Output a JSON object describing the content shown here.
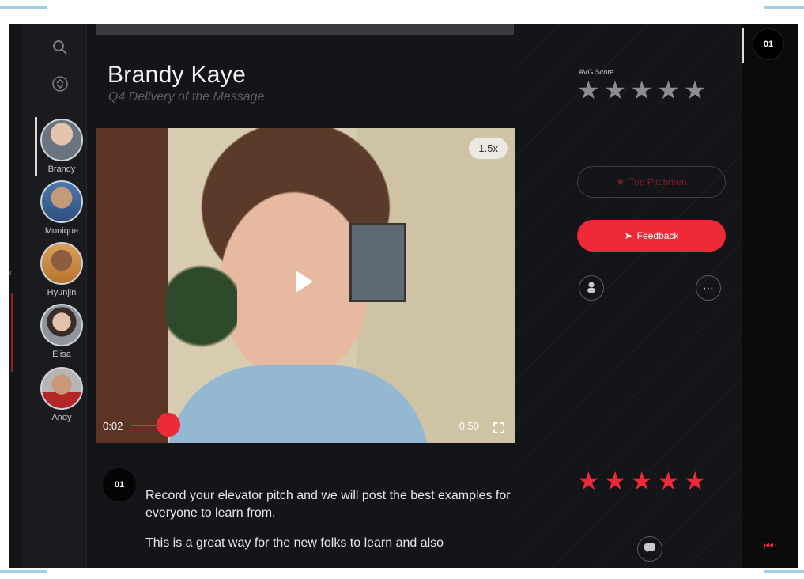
{
  "sidebar": {
    "people": [
      {
        "name": "Brandy"
      },
      {
        "name": "Monique"
      },
      {
        "name": "Hyunjin"
      },
      {
        "name": "Elisa"
      },
      {
        "name": "Andy"
      }
    ]
  },
  "header": {
    "title": "Brandy Kaye",
    "subtitle": "Q4 Delivery of the Message"
  },
  "video": {
    "speed": "1.5x",
    "current_time": "0:02",
    "end_time": "0:50",
    "progress": 0.04
  },
  "score": {
    "label": "AVG Score",
    "avg_stars": 5,
    "user_stars": 5,
    "star_glyph": "★"
  },
  "actions": {
    "top_picks_label": "Top Pitchmen",
    "feedback_label": "Feedback"
  },
  "step": {
    "number": "01",
    "paragraph1": "Record your elevator pitch and we will post the best examples for everyone to learn from.",
    "paragraph2": "This is a great way for the new folks to learn and also"
  },
  "pager": {
    "number": "01"
  },
  "colors": {
    "accent": "#ee2a39",
    "background": "#141518"
  }
}
